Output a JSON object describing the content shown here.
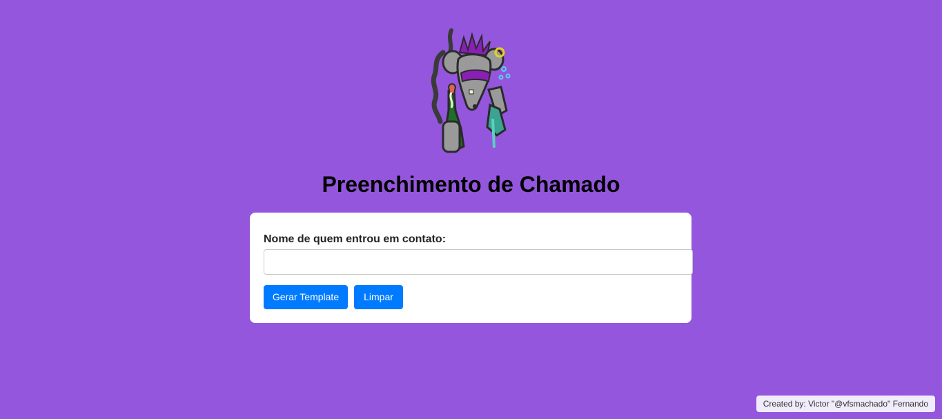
{
  "header": {
    "logo_icon": "punk-rat-chemist-icon",
    "title": "Preenchimento de Chamado"
  },
  "form": {
    "contact_name_label": "Nome de quem entrou em contato:",
    "contact_name_value": "",
    "contact_name_placeholder": "",
    "generate_button_label": "Gerar Template",
    "clear_button_label": "Limpar"
  },
  "footer": {
    "credit": "Created by: Victor \"@vfsmachado\" Fernando"
  },
  "colors": {
    "background": "#9356dc",
    "primary_button": "#007bff",
    "card": "#ffffff"
  }
}
